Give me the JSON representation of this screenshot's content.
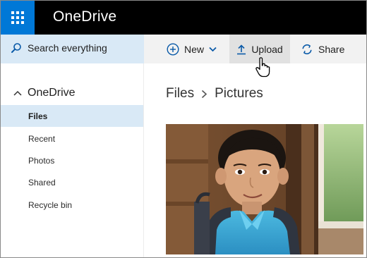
{
  "header": {
    "app_title": "OneDrive",
    "launcher_icon": "app-launcher-waffle-icon"
  },
  "search": {
    "label": "Search everything",
    "icon": "search-icon"
  },
  "commands": {
    "new_label": "New",
    "upload_label": "Upload",
    "share_label": "Share"
  },
  "nav": {
    "root_label": "OneDrive",
    "items": [
      {
        "label": "Files",
        "selected": true
      },
      {
        "label": "Recent",
        "selected": false
      },
      {
        "label": "Photos",
        "selected": false
      },
      {
        "label": "Shared",
        "selected": false
      },
      {
        "label": "Recycle bin",
        "selected": false
      }
    ]
  },
  "breadcrumb": {
    "items": [
      "Files",
      "Pictures"
    ]
  },
  "colors": {
    "accent": "#0078d7",
    "header_bg": "#000000",
    "selected_bg": "#d9e9f6"
  }
}
